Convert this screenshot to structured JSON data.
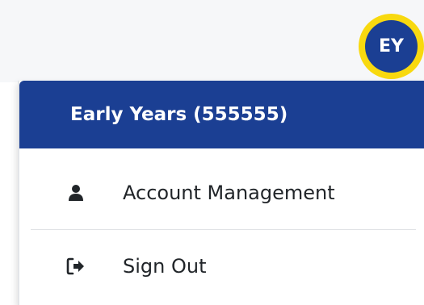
{
  "avatar": {
    "initials": "EY",
    "ring_color": "#f8d90f",
    "fill_color": "#1b3f93"
  },
  "dropdown": {
    "header_label": "Early Years (555555)",
    "header_color": "#1b3f93",
    "items": [
      {
        "label": "Account Management",
        "icon": "user-icon"
      },
      {
        "label": "Sign Out",
        "icon": "sign-out-icon"
      }
    ]
  }
}
